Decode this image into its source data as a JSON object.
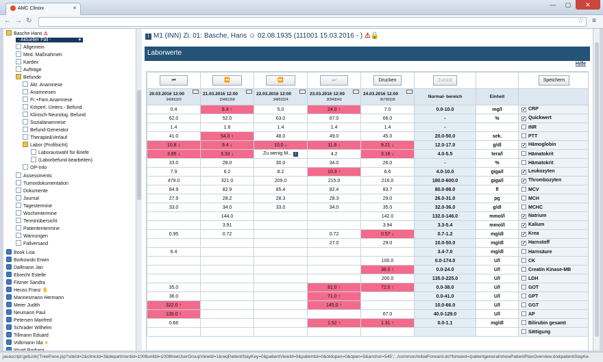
{
  "browser": {
    "tab_title": "AMC Clinixx",
    "status_url": "javascript:getLink('TreePane.jsp?siteId=2&clinicId=3&departmentId=1008unitId=1008treeUserGroupViewId=1&reqPatientStayKey=0&patientViewId=0&patientId=0&oldopen=0&open=5&anchor=545','../common/initialForward.do?forward=/patientgeneral/showPatientPlanOverview.do&patientStayKe"
  },
  "sidebar": {
    "patient": "Basche Hans",
    "fall": "- Aktueller Fall -",
    "items": [
      "Allgemein",
      "Med. Maßnahmen",
      "Kardex",
      "Aufträge",
      "Befunde",
      "Akt. Anamnese",
      "Anamnesen",
      "Fr.+Fam.Anamnese",
      "Körperl. Unters.- Befund",
      "Klinisch-Neurolog. Befund",
      "Sozialanamnese",
      "Befund-Generator",
      "Therapie&Verlauf",
      "Labor (Profilsicht)",
      "Laborauswahl für Briefe",
      "(Laborbefund bearbeiten)",
      "OP-Info",
      "Assessments",
      "Tumordokumentation",
      "Dokumente",
      "Journal",
      "Tagestermine",
      "Wochentermine",
      "Terminübersicht",
      "Patiententermine",
      "Warnungen",
      "Fallversand"
    ],
    "patients": [
      "Book Lisa",
      "Borkowski Erwin",
      "Dallmann Jan",
      "Ebrecht Estelle",
      "Fitzner Sandra",
      "Heuss Franz",
      "Mannesmann Hermann",
      "Meier Judith",
      "Neumann Paul",
      "Petersen Manfred",
      "Schrader Wilhelm",
      "Tillmann Eduard",
      "Volkmann Ida",
      "Wyatt Barbara"
    ]
  },
  "main": {
    "title": "M1 (INN) Zi. 01: Basche, Hans",
    "dob": "02.08.1935 (111001 15.03.2016 - )",
    "section": "Laborwerte",
    "help": "Hilfe",
    "buttons": {
      "first": "⏮",
      "prev": "⏪",
      "next": "⏩",
      "last": "⏭",
      "print": "Drucken",
      "back": "Zurück",
      "save": "Speichern"
    },
    "headers": {
      "dates": [
        {
          "d": "20.03.2016 12:00",
          "n": "34065320"
        },
        {
          "d": "21.03.2016 12:00",
          "n": "33481268"
        },
        {
          "d": "22.03.2016 12:00",
          "n": "34853324"
        },
        {
          "d": "23.03.2016 12:00",
          "n": "30943043"
        },
        {
          "d": "24.03.2016 12:00",
          "n": "36790328"
        }
      ],
      "normal": "Normal- bereich",
      "unit": "Einheit"
    },
    "rows": [
      {
        "v": [
          "0.4",
          "8.4 ↑",
          "5.0",
          "24.0 ↑",
          "7.0"
        ],
        "f": [
          "",
          "h",
          "",
          "h",
          ""
        ],
        "n": "0.0-10.0",
        "u": "mg/l",
        "c": true,
        "l": "CRP"
      },
      {
        "v": [
          "62.0",
          "52.0",
          "63.0",
          "67.0",
          "66.0"
        ],
        "f": [
          "",
          "",
          "",
          "",
          ""
        ],
        "n": "-",
        "u": "%",
        "c": true,
        "l": "Quickwert"
      },
      {
        "v": [
          "1.4",
          "1.6",
          "1.4",
          "1.4",
          "1.4"
        ],
        "f": [
          "",
          "",
          "",
          "",
          ""
        ],
        "n": "-",
        "u": "",
        "c": false,
        "l": "INR"
      },
      {
        "v": [
          "41.0",
          "54.0 ↑",
          "48.0",
          "49.0",
          "45.0"
        ],
        "f": [
          "",
          "h",
          "",
          "",
          ""
        ],
        "n": "20.0-50.0",
        "u": "sek.",
        "c": false,
        "l": "PTT"
      },
      {
        "v": [
          "10.8 ↓",
          "9.4 ↓",
          "10.0 ↓",
          "11.8 ↓",
          "9.21 ↓"
        ],
        "f": [
          "h",
          "h",
          "h",
          "h",
          "h"
        ],
        "n": "12.0-17.0",
        "u": "g/dl",
        "c": true,
        "l": "Hämoglobin"
      },
      {
        "v": [
          "3.85 ↓",
          "3.33 ↓",
          "Zu wenig M...",
          "4.2",
          "3.16 ↓"
        ],
        "f": [
          "h",
          "h",
          "",
          "",
          "h"
        ],
        "n": "4.0-5.5",
        "u": "tera/l",
        "c": false,
        "l": "Hämatokrit"
      },
      {
        "v": [
          "33.0",
          "28.0",
          "30.0",
          "34.0",
          "26.0"
        ],
        "f": [
          "",
          "",
          "",
          "",
          ""
        ],
        "n": "-",
        "u": "%",
        "c": false,
        "l": "Hämatokrit"
      },
      {
        "v": [
          "7.9",
          "6.2",
          "8.2",
          "10.3 ↑",
          "6.6"
        ],
        "f": [
          "",
          "",
          "",
          "h",
          ""
        ],
        "n": "4.0-10.0",
        "u": "giga/l",
        "c": true,
        "l": "Leukozyten"
      },
      {
        "v": [
          "479.0",
          "321.0",
          "209.0",
          "215.0",
          "216.0"
        ],
        "f": [
          "",
          "",
          "",
          "",
          ""
        ],
        "n": "180.0-600.0",
        "u": "giga/l",
        "c": true,
        "l": "Thrombozyten"
      },
      {
        "v": [
          "84.9",
          "82.9",
          "85.4",
          "82.4",
          "83.7"
        ],
        "f": [
          "",
          "",
          "",
          "",
          ""
        ],
        "n": "80.0-98.0",
        "u": "fl",
        "c": false,
        "l": "MCV"
      },
      {
        "v": [
          "27.9",
          "28.2",
          "28.3",
          "28.3",
          "29.0"
        ],
        "f": [
          "",
          "",
          "",
          "",
          ""
        ],
        "n": "26.0-31.0",
        "u": "pg",
        "c": false,
        "l": "MCH"
      },
      {
        "v": [
          "33.0",
          "34.0",
          "33.0",
          "34.0",
          "35.0"
        ],
        "f": [
          "",
          "",
          "",
          "",
          ""
        ],
        "n": "32.0-36.0",
        "u": "g/dl",
        "c": false,
        "l": "MCHC"
      },
      {
        "v": [
          "",
          "144.0",
          "",
          "",
          "142.0"
        ],
        "f": [
          "",
          "",
          "",
          "",
          ""
        ],
        "n": "132.0-146.0",
        "u": "mmol/l",
        "c": true,
        "l": "Natrium"
      },
      {
        "v": [
          "",
          "3.91",
          "",
          "",
          "3.94"
        ],
        "f": [
          "",
          "",
          "",
          "",
          ""
        ],
        "n": "3.3-5.4",
        "u": "mmol/l",
        "c": true,
        "l": "Kalium"
      },
      {
        "v": [
          "0.95",
          "0.72",
          "",
          "0.72",
          "0.57 ↓"
        ],
        "f": [
          "",
          "",
          "",
          "",
          "h"
        ],
        "n": "0.7-1.2",
        "u": "mg/dl",
        "c": true,
        "l": "Krea"
      },
      {
        "v": [
          "",
          "",
          "",
          "27.0",
          "29.0"
        ],
        "f": [
          "",
          "",
          "",
          "",
          ""
        ],
        "n": "10.0-50.0",
        "u": "mg/dl",
        "c": true,
        "l": "Harnstoff"
      },
      {
        "v": [
          "6.4",
          "",
          "",
          "",
          ""
        ],
        "f": [
          "",
          "",
          "",
          "",
          ""
        ],
        "n": "3.4-7.0",
        "u": "mg/dl",
        "c": false,
        "l": "Harnsäure"
      },
      {
        "v": [
          "",
          "",
          "",
          "",
          "100.0"
        ],
        "f": [
          "",
          "",
          "",
          "",
          ""
        ],
        "n": "0.0-174.0",
        "u": "U/l",
        "c": false,
        "l": "CK"
      },
      {
        "v": [
          "",
          "",
          "",
          "",
          "36.0 ↑"
        ],
        "f": [
          "",
          "",
          "",
          "",
          "h"
        ],
        "n": "0.0-24.0",
        "u": "U/l",
        "c": false,
        "l": "Creatin Kinase-MB"
      },
      {
        "v": [
          "",
          "",
          "",
          "",
          "200.0"
        ],
        "f": [
          "",
          "",
          "",
          "",
          ""
        ],
        "n": "135.0-225.0",
        "u": "U/l",
        "c": false,
        "l": "LDH"
      },
      {
        "v": [
          "35.0",
          "",
          "",
          "81.0 ↑",
          "72.0 ↑"
        ],
        "f": [
          "",
          "",
          "",
          "h",
          "h"
        ],
        "n": "0.0-38.0",
        "u": "U/l",
        "c": false,
        "l": "GOT"
      },
      {
        "v": [
          "36.0",
          "",
          "",
          "71.0 ↑",
          ""
        ],
        "f": [
          "",
          "",
          "",
          "h",
          ""
        ],
        "n": "0.0-41.0",
        "u": "U/l",
        "c": false,
        "l": "GPT"
      },
      {
        "v": [
          "322.0 ↑",
          "",
          "",
          "145.0 ↑",
          ""
        ],
        "f": [
          "h",
          "",
          "",
          "h",
          ""
        ],
        "n": "10.0-66.0",
        "u": "U/l",
        "c": false,
        "l": "GGT"
      },
      {
        "v": [
          "139.0 ↑",
          "",
          "",
          "",
          "67.0"
        ],
        "f": [
          "h",
          "",
          "",
          "",
          ""
        ],
        "n": "40.0-129.0",
        "u": "U/l",
        "c": false,
        "l": "AP"
      },
      {
        "v": [
          "0.66",
          "",
          "",
          "1.52 ↑",
          "1.31 ↑"
        ],
        "f": [
          "",
          "",
          "",
          "h",
          "h"
        ],
        "n": "0.0-1.1",
        "u": "mg/dl",
        "c": false,
        "l": "Bilirubin gesamt"
      },
      {
        "v": [
          "",
          "",
          "",
          "",
          ""
        ],
        "f": [
          "",
          "",
          "",
          "",
          ""
        ],
        "n": "",
        "u": "",
        "c": false,
        "l": "Sättigung"
      }
    ]
  }
}
